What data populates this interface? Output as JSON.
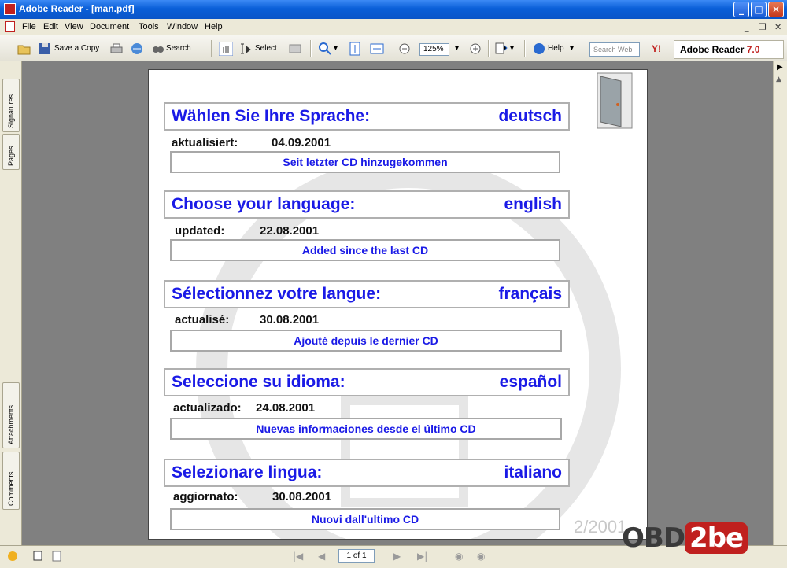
{
  "window": {
    "title": "Adobe Reader - [man.pdf]",
    "minimize": "_",
    "maximize": "□",
    "close": "✕"
  },
  "menu": {
    "items": [
      "File",
      "Edit",
      "View",
      "Document",
      "Tools",
      "Window",
      "Help"
    ],
    "mdi_min": "_",
    "mdi_restore": "❐",
    "mdi_close": "✕"
  },
  "toolbar": {
    "save_copy": "Save a Copy",
    "search": "Search",
    "select": "Select",
    "zoom": "125%",
    "help": "Help",
    "search_web": "Search Web",
    "yahoo": "Y!",
    "brand_a": "Adobe",
    "brand_b": " Reader",
    "brand_c": "7.0"
  },
  "leftnav": {
    "signatures": "Signatures",
    "pages": "Pages",
    "attachments": "Attachments",
    "comments": "Comments"
  },
  "sections": [
    {
      "title": "Wählen Sie Ihre Sprache:",
      "lang": "deutsch",
      "updated_label": "aktualisiert:",
      "updated_date": "04.09.2001",
      "new_label": "Seit letzter CD hinzugekommen"
    },
    {
      "title": "Choose your language:",
      "lang": "english",
      "updated_label": "updated:",
      "updated_date": "22.08.2001",
      "new_label": "Added since the last CD"
    },
    {
      "title": "Sélectionnez votre langue:",
      "lang": "français",
      "updated_label": "actualisé:",
      "updated_date": "30.08.2001",
      "new_label": "Ajouté depuis le dernier CD"
    },
    {
      "title": "Seleccione su idioma:",
      "lang": "español",
      "updated_label": "actualizado:",
      "updated_date": "24.08.2001",
      "new_label": "Nuevas informaciones desde el último CD"
    },
    {
      "title": "Selezionare lingua:",
      "lang": "italiano",
      "updated_label": "aggiornato:",
      "updated_date": "30.08.2001",
      "new_label": "Nuovi dall'ultimo CD"
    }
  ],
  "page": {
    "year": "2/2001"
  },
  "status": {
    "page_count": "1 of 1"
  },
  "watermark": {
    "a": "OBD",
    "b": "2be"
  },
  "colors": {
    "link_blue": "#1a1ae6",
    "title_bar": "#0a5fd8"
  }
}
